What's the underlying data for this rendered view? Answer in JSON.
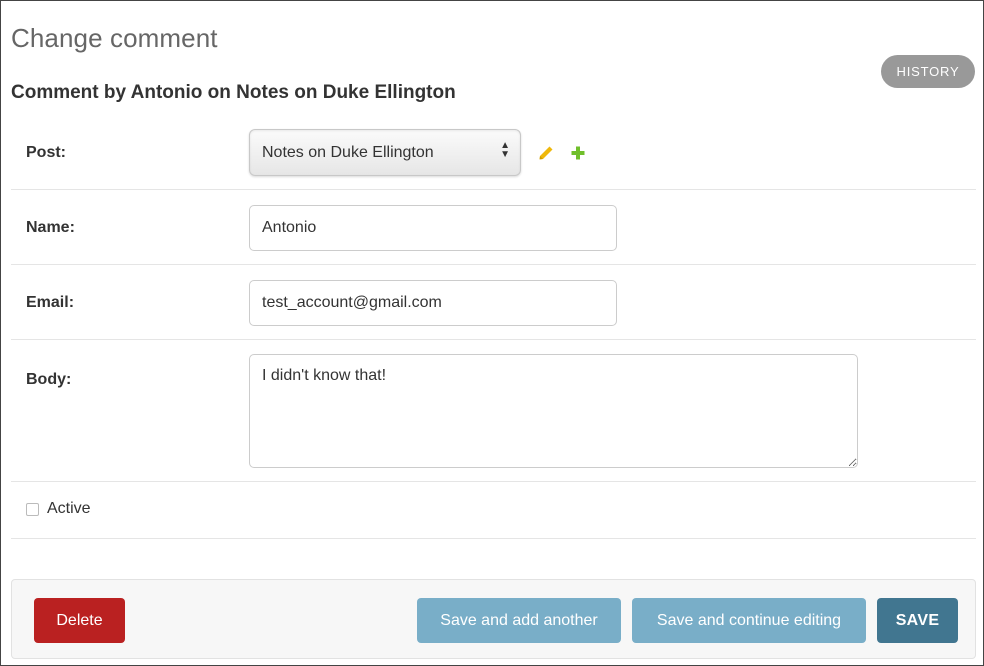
{
  "header": {
    "title": "Change comment",
    "history_label": "HISTORY",
    "subtitle": "Comment by Antonio on Notes on Duke Ellington"
  },
  "form": {
    "post": {
      "label": "Post:",
      "selected": "Notes on Duke Ellington"
    },
    "name": {
      "label": "Name:",
      "value": "Antonio"
    },
    "email": {
      "label": "Email:",
      "value": "test_account@gmail.com"
    },
    "body": {
      "label": "Body:",
      "value": "I didn't know that!"
    },
    "active": {
      "label": "Active",
      "checked": false
    }
  },
  "icons": {
    "edit": "pencil-icon",
    "add": "plus-icon",
    "edit_color": "#efb80b",
    "add_color": "#70bf2b"
  },
  "submit_row": {
    "delete_label": "Delete",
    "save_add_another_label": "Save and add another",
    "save_continue_label": "Save and continue editing",
    "save_label": "SAVE"
  },
  "colors": {
    "delete": "#ba2121",
    "secondary": "#79aec8",
    "primary": "#417690",
    "history": "#999999"
  }
}
